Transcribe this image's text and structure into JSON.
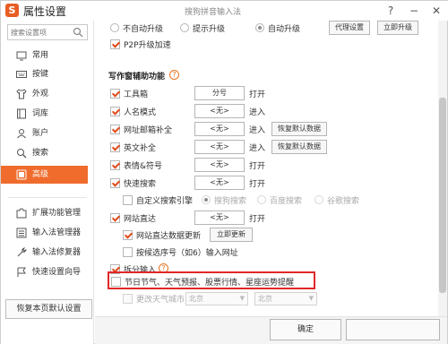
{
  "window": {
    "logo_char": "S",
    "title": "属性设置",
    "subtitle": "搜狗拼音输入法",
    "help_label": "?",
    "minimize_label": "−",
    "close_label": "✕"
  },
  "sidebar": {
    "search_placeholder": "搜索设置项",
    "items": [
      {
        "label": "常用",
        "icon": "monitor-icon"
      },
      {
        "label": "按键",
        "icon": "keyboard-icon"
      },
      {
        "label": "外观",
        "icon": "shirt-icon"
      },
      {
        "label": "词库",
        "icon": "book-icon"
      },
      {
        "label": "账户",
        "icon": "user-icon"
      },
      {
        "label": "搜索",
        "icon": "search-icon"
      },
      {
        "label": "高级",
        "icon": "advanced-icon",
        "active": true
      }
    ],
    "tools": [
      {
        "label": "扩展功能管理",
        "icon": "puzzle-icon"
      },
      {
        "label": "输入法管理器",
        "icon": "list-icon"
      },
      {
        "label": "输入法修复器",
        "icon": "repair-icon"
      },
      {
        "label": "快速设置向导",
        "icon": "wizard-icon"
      }
    ],
    "restore_button": "恢复本页默认设置"
  },
  "content": {
    "upgrade": {
      "options": [
        "不自动升级",
        "提示升级",
        "自动升级"
      ],
      "selected": "自动升级",
      "proxy_button": "代理设置",
      "upgrade_now_button": "立即升级",
      "p2p_label": "P2P升级加速",
      "p2p_checked": true
    },
    "writing": {
      "title": "写作窗辅助功能",
      "help": "?",
      "toolbox": {
        "label": "工具箱",
        "checked": true,
        "key": "分号",
        "action": "打开"
      },
      "person_mode": {
        "label": "人名模式",
        "checked": true,
        "key": "<无>",
        "action": "进入"
      },
      "url_email": {
        "label": "网址邮箱补全",
        "checked": true,
        "key": "<无>",
        "action": "进入",
        "restore": "恢复默认数据"
      },
      "english": {
        "label": "英文补全",
        "checked": true,
        "key": "<无>",
        "action": "进入",
        "restore": "恢复默认数据"
      },
      "emoji": {
        "label": "表情&符号",
        "checked": true,
        "key": "<无>",
        "action": "打开"
      },
      "quick_search": {
        "label": "快速搜索",
        "checked": true,
        "key": "<无>",
        "action": "打开"
      },
      "custom_engine": {
        "label": "自定义搜索引擎",
        "checked": false,
        "engines": [
          "搜狗搜索",
          "百度搜索",
          "谷歌搜索"
        ],
        "selected": "搜狗搜索"
      },
      "site_direct": {
        "label": "网站直达",
        "checked": true,
        "key": "<无>",
        "action": "打开"
      },
      "site_data_update": {
        "label": "网站直达数据更新",
        "checked": true,
        "button": "立即更新"
      },
      "candidate_select": {
        "label": "按候选序号（如6）输入网址",
        "checked": false
      },
      "split_input": {
        "label": "拆分输入",
        "checked": true,
        "help": "?"
      },
      "festival": {
        "label": "节日节气、天气预报、股票行情、星座运势提醒",
        "checked": false
      },
      "weather_city": {
        "label": "更改天气城市",
        "checked": false,
        "province": "北京",
        "city": "北京"
      }
    }
  },
  "footer": {
    "ok_button": "确定",
    "cancel_button": ""
  },
  "colors": {
    "accent": "#f06c2d",
    "check": "#e04b1b",
    "highlight": "#e0272a"
  }
}
